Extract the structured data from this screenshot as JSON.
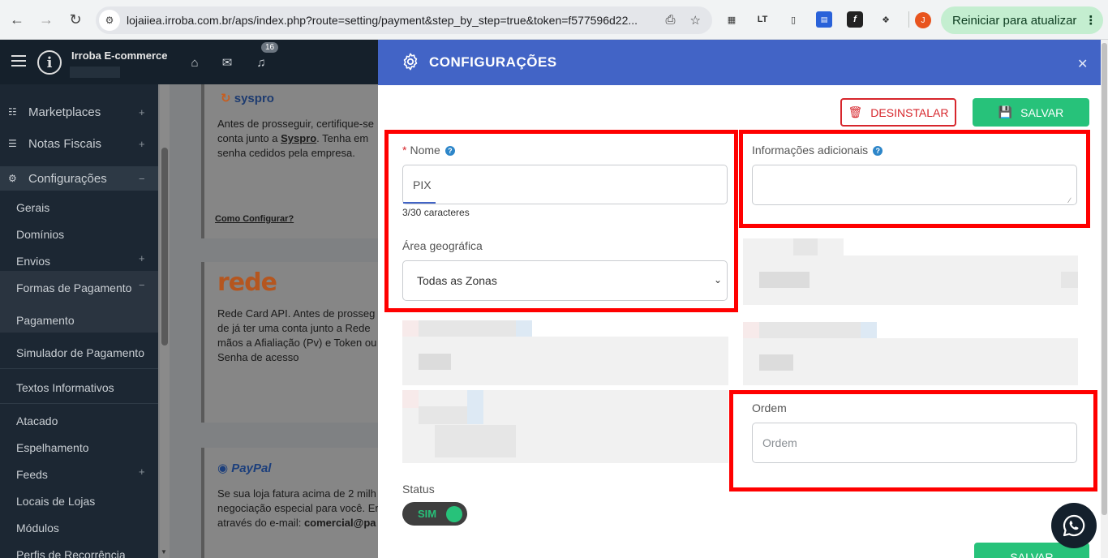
{
  "browser": {
    "url": "lojaiiea.irroba.com.br/aps/index.php?route=setting/payment&step_by_step=true&token=f577596d22...",
    "update_button": "Reiniciar para atualizar",
    "avatar_initial": "J"
  },
  "header": {
    "brand": "Irroba E-commerce",
    "notification_count": "16"
  },
  "sidebar": {
    "items": [
      {
        "label": "Marketplaces"
      },
      {
        "label": "Notas Fiscais"
      },
      {
        "label": "Configurações"
      }
    ],
    "sub_items": [
      "Gerais",
      "Domínios",
      "Envios",
      "Formas de Pagamento",
      "Pagamento",
      "Simulador de Pagamento",
      "Textos Informativos",
      "Atacado",
      "Espelhamento",
      "Feeds",
      "Locais de Lojas",
      "Módulos",
      "Perfis de Recorrência"
    ]
  },
  "background_cards": {
    "syspro": {
      "logo": "syspro",
      "text_1": "Antes de prosseguir, certifique-se",
      "text_2a": "conta junto a ",
      "text_2b": "Syspro",
      "text_2c": ". Tenha em",
      "text_3": "senha cedidos pela empresa.",
      "link": "Como Configurar?"
    },
    "rede": {
      "logo": "rede",
      "lines": [
        "Rede Card API. Antes de prosseg",
        "de já ter uma conta junto a Rede",
        "mãos a Afialiação (Pv) e Token ou",
        "Senha de acesso"
      ]
    },
    "paypal": {
      "logo": "PayPal",
      "line_1": "Se sua loja fatura acima de 2 milh",
      "line_2": "negociação especial para você. En",
      "line_3a": "através do e-mail: ",
      "line_3b": "comercial@pa"
    }
  },
  "modal": {
    "title": "CONFIGURAÇÕES",
    "uninstall_label": "DESINSTALAR",
    "save_label": "SALVAR",
    "save_bottom_label": "SALVAR",
    "nome": {
      "label": "Nome",
      "value": "PIX",
      "counter": "3/30 caracteres"
    },
    "info_adicionais": {
      "label": "Informações adicionais",
      "value": ""
    },
    "area": {
      "label": "Área geográfica",
      "selected": "Todas as Zonas"
    },
    "ordem": {
      "label": "Ordem",
      "placeholder": "Ordem"
    },
    "status": {
      "label": "Status",
      "value": "SIM"
    }
  },
  "colors": {
    "modal_header": "#4264c6",
    "accent_green": "#27c27a",
    "danger_red": "#d7262c",
    "highlight_red": "#ff0000",
    "sidebar_bg": "#1c2733"
  }
}
